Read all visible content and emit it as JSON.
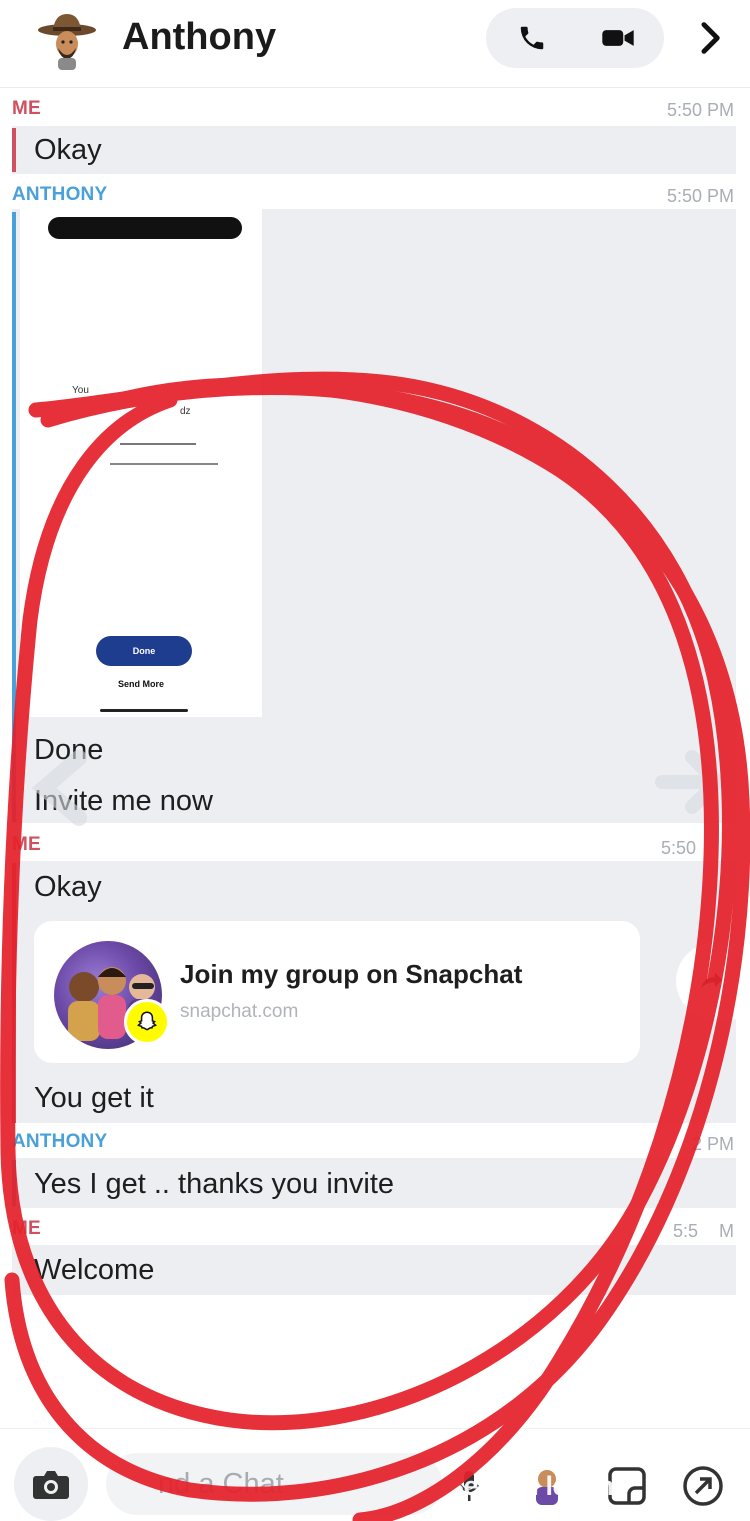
{
  "header": {
    "title": "Anthony",
    "avatar_icon": "bitmoji-cowboy-avatar",
    "voice_call_icon": "phone-icon",
    "video_call_icon": "video-camera-icon",
    "more_icon": "chevron-right-icon"
  },
  "messages": [
    {
      "sender": "ME",
      "time": "5:50 PM",
      "text": "Okay"
    },
    {
      "sender": "ANTHONY",
      "time": "5:50 PM",
      "texts": [
        "Done",
        "Invite me now"
      ]
    },
    {
      "sender": "ME",
      "time": "5:50",
      "texts": [
        "Okay",
        "You get it"
      ]
    },
    {
      "sender": "ANTHONY",
      "time": "2 PM",
      "text": "Yes I get .. thanks you invite"
    },
    {
      "sender": "ME",
      "time": "5:5",
      "time_suffix": "M",
      "text": "Welcome"
    }
  ],
  "attachment": {
    "done_button": "Done",
    "send_more": "Send More",
    "partial_text": "You",
    "partial_text_2": "dz"
  },
  "invite_card": {
    "title": "Join my group on Snapchat",
    "url": "snapchat.com",
    "badge_icon": "snapchat-ghost-icon",
    "share_icon": "share-arrow-icon"
  },
  "composer": {
    "placeholder": "nd a Chat",
    "camera_icon": "camera-icon",
    "mic_icon": "microphone-icon",
    "bitmoji_icon": "bitmoji-sticker-icon",
    "sticker_icon": "sticker-icon",
    "games_icon": "rocket-icon"
  },
  "watermark": "Sex ngi      le   om",
  "colors": {
    "me_accent": "#d0505f",
    "them_accent": "#4aa0d8",
    "marker_red": "#e5222c",
    "bubble_bg": "#eceef2"
  }
}
